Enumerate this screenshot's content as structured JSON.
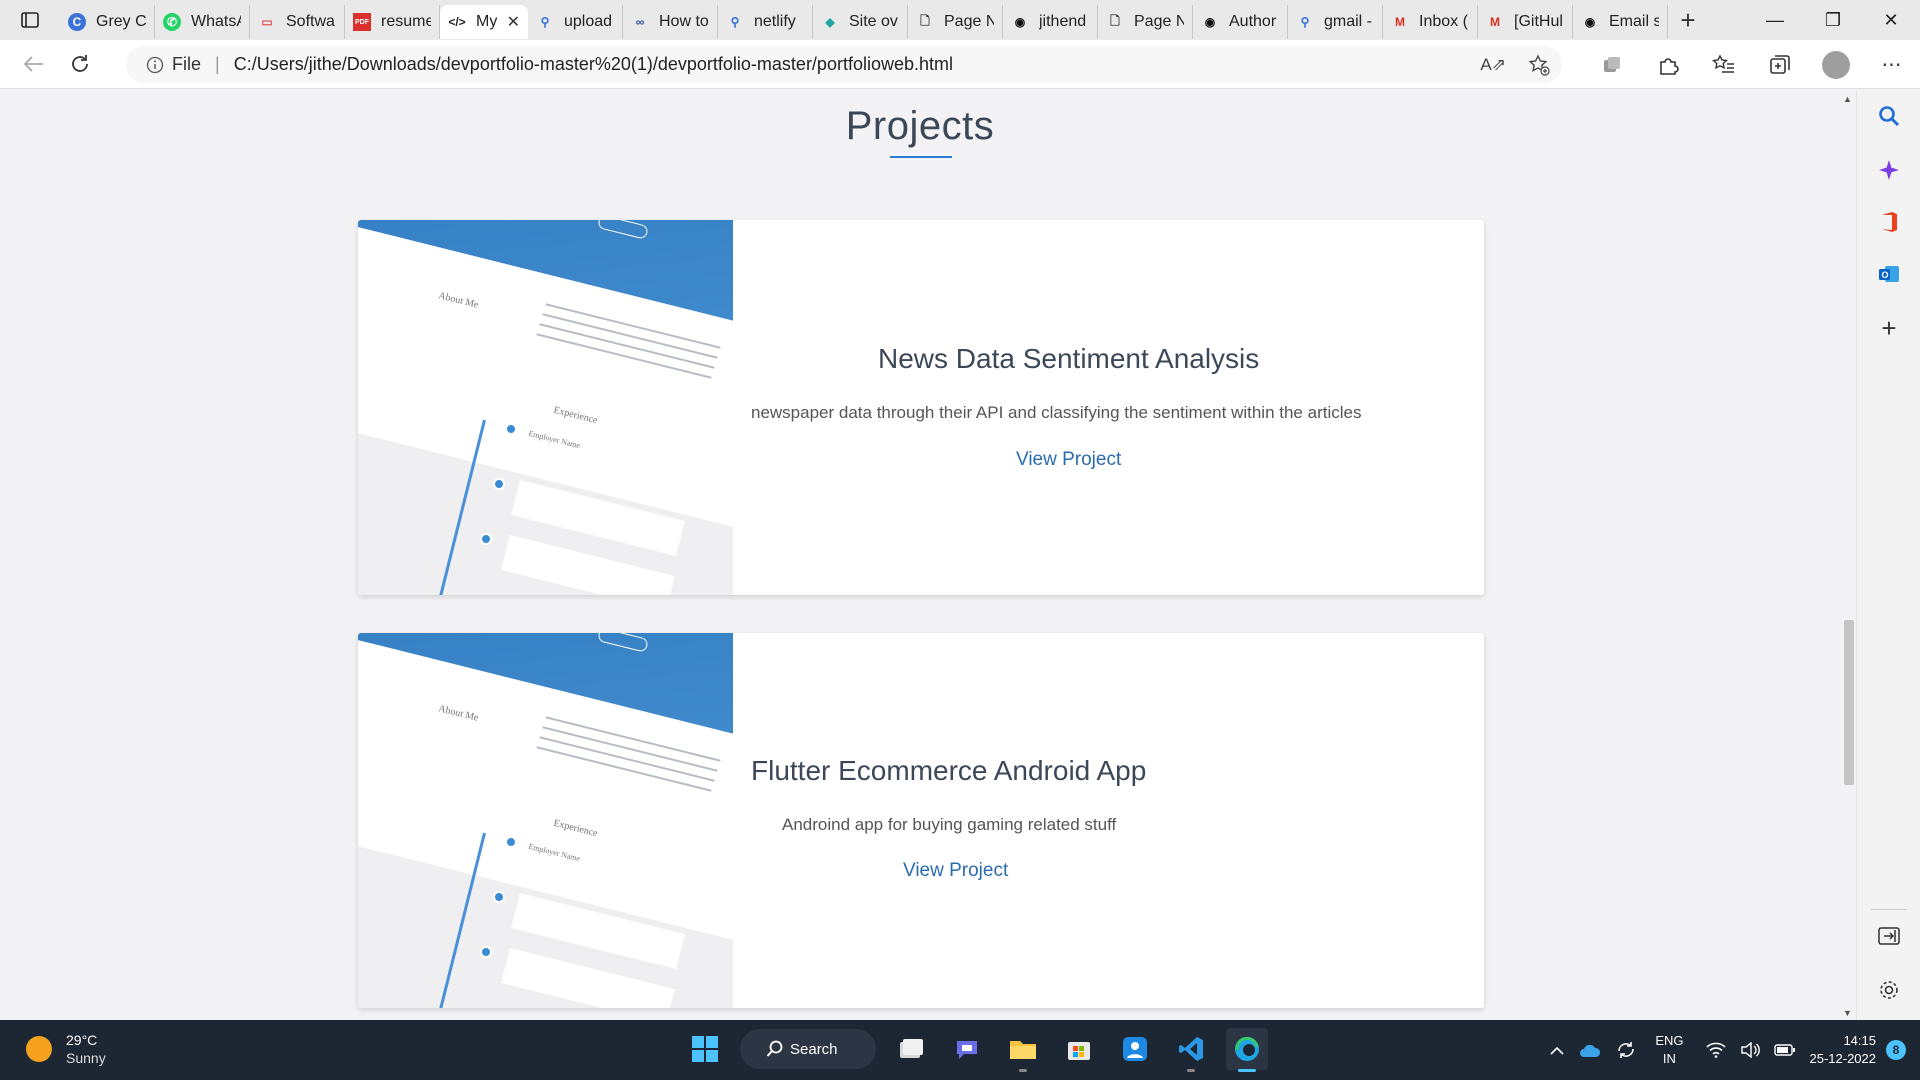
{
  "browser": {
    "tabs": [
      {
        "title": "Grey Cl",
        "icon": "grey-c-icon",
        "color": "#3b73d9"
      },
      {
        "title": "WhatsA",
        "icon": "whatsapp-icon",
        "color": "#25d366"
      },
      {
        "title": "Softwa",
        "icon": "software-icon",
        "color": "#e05a5a"
      },
      {
        "title": "resume",
        "icon": "pdf-icon",
        "color": "#d9302c"
      },
      {
        "title": "My",
        "icon": "code-icon",
        "color": "#222222",
        "active": true
      },
      {
        "title": "upload",
        "icon": "search-icon",
        "color": "#2b6fd6"
      },
      {
        "title": "How to",
        "icon": "copilot-icon",
        "color": "#2b4fa8"
      },
      {
        "title": "netlify",
        "icon": "search-icon",
        "color": "#2b6fd6"
      },
      {
        "title": "Site ov",
        "icon": "netlify-icon",
        "color": "#20a6a5"
      },
      {
        "title": "Page N",
        "icon": "page-icon",
        "color": "#333333"
      },
      {
        "title": "jithend",
        "icon": "github-icon",
        "color": "#111111"
      },
      {
        "title": "Page N",
        "icon": "page-icon",
        "color": "#333333"
      },
      {
        "title": "Author",
        "icon": "github-icon",
        "color": "#111111"
      },
      {
        "title": "gmail -",
        "icon": "search-icon",
        "color": "#2b6fd6"
      },
      {
        "title": "Inbox (",
        "icon": "gmail-icon",
        "color": "#d93025"
      },
      {
        "title": "[GitHul",
        "icon": "gmail-icon",
        "color": "#d93025"
      },
      {
        "title": "Email s",
        "icon": "github-icon",
        "color": "#111111"
      }
    ],
    "address": {
      "scheme_label": "File",
      "url": "C:/Users/jithe/Downloads/devportfolio-master%20(1)/devportfolio-master/portfolioweb.html"
    }
  },
  "page": {
    "section_title": "Projects",
    "projects": [
      {
        "title": "News Data Sentiment Analysis",
        "description": "newspaper data through their API and classifying the sentiment within the articles",
        "link": "View Project"
      },
      {
        "title": "Flutter Ecommerce Android App",
        "description": "Androind app for buying gaming related stuff",
        "link": "View Project"
      }
    ],
    "thumbnail": {
      "about_label": "About Me",
      "experience_label": "Experience",
      "employer_label": "Employer Name"
    }
  },
  "taskbar": {
    "weather_temp": "29°C",
    "weather_desc": "Sunny",
    "search_label": "Search",
    "lang_line1": "ENG",
    "lang_line2": "IN",
    "time": "14:15",
    "date": "25-12-2022",
    "notifications": "8"
  },
  "colors": {
    "accent": "#2b7bd0",
    "link": "#2b6bb0",
    "taskbar_bg": "#1d2633"
  }
}
